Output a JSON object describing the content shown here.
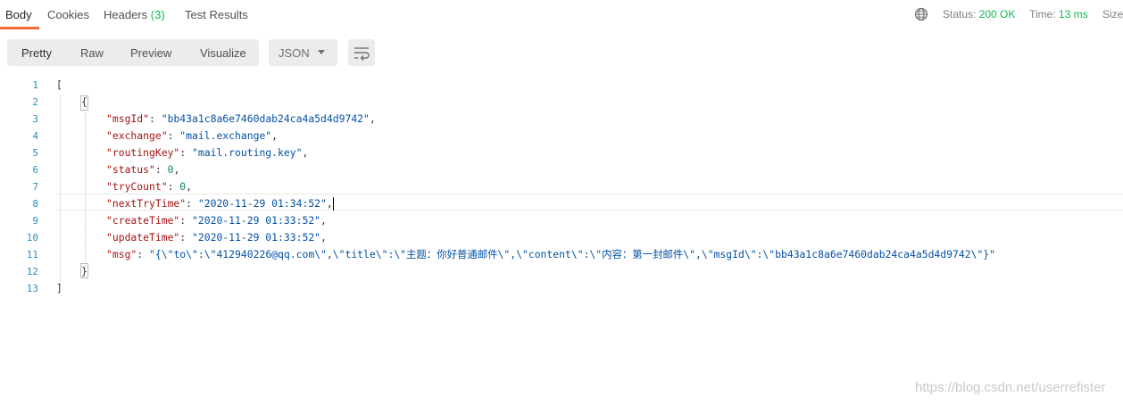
{
  "tabs": {
    "body": "Body",
    "cookies": "Cookies",
    "headers": "Headers",
    "headers_count": "(3)",
    "test_results": "Test Results"
  },
  "meta": {
    "status_label": "Status:",
    "status_value": "200 OK",
    "time_label": "Time:",
    "time_value": "13 ms",
    "size_label": "Size"
  },
  "toolbar": {
    "pretty": "Pretty",
    "raw": "Raw",
    "preview": "Preview",
    "visualize": "Visualize",
    "format": "JSON"
  },
  "editor": {
    "line_numbers": [
      "1",
      "2",
      "3",
      "4",
      "5",
      "6",
      "7",
      "8",
      "9",
      "10",
      "11",
      "12",
      "13"
    ],
    "open_bracket": "[",
    "open_brace": "{",
    "close_brace": "}",
    "close_bracket": "]",
    "fields": [
      {
        "key": "\"msgId\"",
        "value": "\"bb43a1c8a6e7460dab24ca4a5d4d9742\"",
        "type": "str"
      },
      {
        "key": "\"exchange\"",
        "value": "\"mail.exchange\"",
        "type": "str"
      },
      {
        "key": "\"routingKey\"",
        "value": "\"mail.routing.key\"",
        "type": "str"
      },
      {
        "key": "\"status\"",
        "value": "0",
        "type": "num"
      },
      {
        "key": "\"tryCount\"",
        "value": "0",
        "type": "num"
      },
      {
        "key": "\"nextTryTime\"",
        "value": "\"2020-11-29 01:34:52\"",
        "type": "str"
      },
      {
        "key": "\"createTime\"",
        "value": "\"2020-11-29 01:33:52\"",
        "type": "str"
      },
      {
        "key": "\"updateTime\"",
        "value": "\"2020-11-29 01:33:52\"",
        "type": "str"
      },
      {
        "key": "\"msg\"",
        "value": "\"{\\\"to\\\":\\\"412940226@qq.com\\\",\\\"title\\\":\\\"主题：你好普通邮件\\\",\\\"content\\\":\\\"内容：第一封邮件\\\",\\\"msgId\\\":\\\"bb43a1c8a6e7460dab24ca4a5d4d9742\\\"}\"",
        "type": "str",
        "last": true
      }
    ]
  },
  "watermark": "https://blog.csdn.net/userrefister",
  "colors": {
    "accent": "#f26b3a",
    "success": "#0cbb52",
    "line_number": "#2a8fbd",
    "key": "#a31515",
    "string": "#0451a5",
    "number": "#098658"
  }
}
